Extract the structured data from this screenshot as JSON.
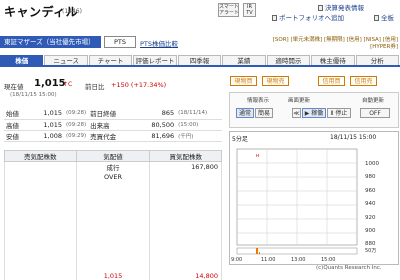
{
  "header": {
    "title": "キャンディル",
    "code": "(1446)",
    "chips": [
      "スマート\nアラート",
      "IR\nTV"
    ],
    "links": [
      "決算発表情報",
      "ポートフォリオへ追加",
      "全板"
    ]
  },
  "market": {
    "selected": "東証マザーズ（当社優先市場）",
    "pts_label": "PTS",
    "pts_compare": "PTS株価比較",
    "tags_line1": "[SOR] [単元未満株] [無期限] [信用] [NISA] [信用]",
    "tags_line2": "[HYPER券]"
  },
  "tabs": [
    "株価",
    "ニュース",
    "チャート",
    "評価レポート",
    "四季報",
    "業績",
    "適時開示",
    "株主優待",
    "分析"
  ],
  "quote": {
    "label_now": "現在値",
    "price": "1,015",
    "unit": "↑C",
    "timestamp": "(18/11/15 15:00)",
    "label_prev": "前日比",
    "change": "+150 (+17.34%)"
  },
  "stats": {
    "rows": [
      [
        "始値",
        "1,015",
        "(09:28)",
        "前日終値",
        "865",
        "(18/11/14)"
      ],
      [
        "高値",
        "1,015",
        "(09:28)",
        "出来高",
        "80,500",
        "(15:00)"
      ],
      [
        "安値",
        "1,008",
        "(09:29)",
        "売買代金",
        "81,696",
        "(千円)"
      ]
    ]
  },
  "board": {
    "headers": [
      "売気配株数",
      "気配値",
      "買気配株数"
    ],
    "rows": [
      [
        "",
        "成行",
        "167,800"
      ],
      [
        "",
        "OVER",
        ""
      ],
      [
        "",
        "",
        ""
      ],
      [
        "",
        "",
        ""
      ],
      [
        "",
        "",
        ""
      ],
      [
        "",
        "",
        ""
      ],
      [
        "",
        "",
        ""
      ],
      [
        "",
        "",
        ""
      ],
      [
        "",
        "",
        ""
      ],
      [
        "",
        "",
        ""
      ],
      [
        "",
        "",
        ""
      ],
      [
        "",
        "",
        ""
      ],
      [
        "",
        "1,015",
        "14,800"
      ]
    ]
  },
  "actions": {
    "buy_cash": "現物買",
    "sell_cash": "現物売",
    "buy_margin": "信用買",
    "sell_margin": "信用売"
  },
  "controls": {
    "display_label": "情報表示",
    "mode_label": "画面更新",
    "auto_label": "自動更新",
    "normal": "通常",
    "simple": "簡易",
    "prev_btn": "≪",
    "play": "▶ 稼働",
    "pause": "Ⅱ 停止",
    "off": "OFF"
  },
  "chart_info": {
    "interval": "5分足",
    "datetime": "18/11/15 15:00",
    "y_ticks": [
      "1000",
      "980",
      "960",
      "940",
      "920",
      "900",
      "880"
    ],
    "x_ticks": [
      "9:00",
      "11:00",
      "13:00",
      "15:00"
    ],
    "vol_label": "50万",
    "credit": "(c)Quants Research Inc."
  },
  "colors": {
    "accent": "#2f5bb7",
    "up": "#d00000",
    "volume": "#f07800"
  }
}
